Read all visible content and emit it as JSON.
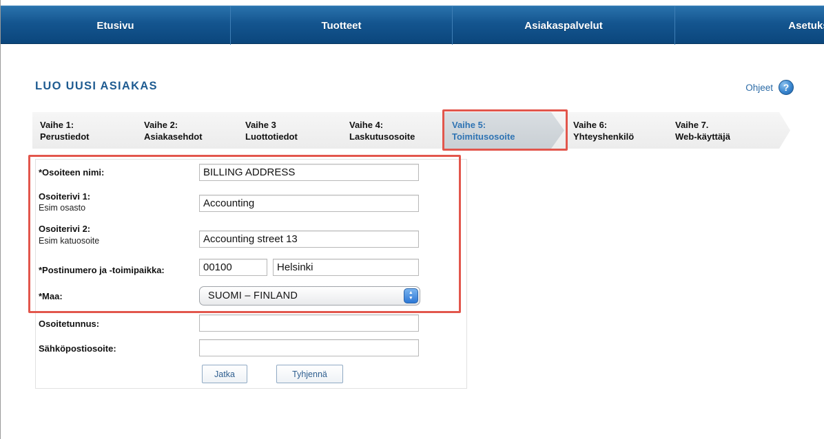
{
  "nav": {
    "items": [
      {
        "label": "Etusivu"
      },
      {
        "label": "Tuotteet"
      },
      {
        "label": "Asiakaspalvelut"
      },
      {
        "label": "Asetukse"
      }
    ]
  },
  "page": {
    "title": "LUO UUSI ASIAKAS",
    "help_label": "Ohjeet",
    "help_icon": "?"
  },
  "steps": [
    {
      "num": "Vaihe 1:",
      "label": "Perustiedot"
    },
    {
      "num": "Vaihe 2:",
      "label": "Asiakasehdot"
    },
    {
      "num": "Vaihe 3",
      "label": "Luottotiedot"
    },
    {
      "num": "Vaihe 4:",
      "label": "Laskutusosoite"
    },
    {
      "num": "Vaihe 5:",
      "label": "Toimitusosoite",
      "active": true
    },
    {
      "num": "Vaihe 6:",
      "label": "Yhteyshenkilö"
    },
    {
      "num": "Vaihe 7.",
      "label": "Web-käyttäjä"
    }
  ],
  "form": {
    "address_name": {
      "label": "*Osoiteen nimi:",
      "value": "BILLING ADDRESS"
    },
    "address_line1": {
      "label": "Osoiterivi 1:",
      "hint": "Esim osasto",
      "value": "Accounting"
    },
    "address_line2": {
      "label": "Osoiterivi 2:",
      "hint": "Esim katuosoite",
      "value": "Accounting street 13"
    },
    "postal": {
      "label": "*Postinumero ja -toimipaikka:",
      "code": "00100",
      "city": "Helsinki"
    },
    "country": {
      "label": "*Maa:",
      "selected": "SUOMI – FINLAND"
    },
    "address_id": {
      "label": "Osoitetunnus:",
      "value": ""
    },
    "email": {
      "label": "Sähköpostiosoite:",
      "value": ""
    },
    "continue_label": "Jatka",
    "clear_label": "Tyhjennä"
  },
  "colors": {
    "nav": "#14558f",
    "title": "#1e5b91",
    "active_step": "#2e73b3",
    "highlight": "#e2564c"
  }
}
